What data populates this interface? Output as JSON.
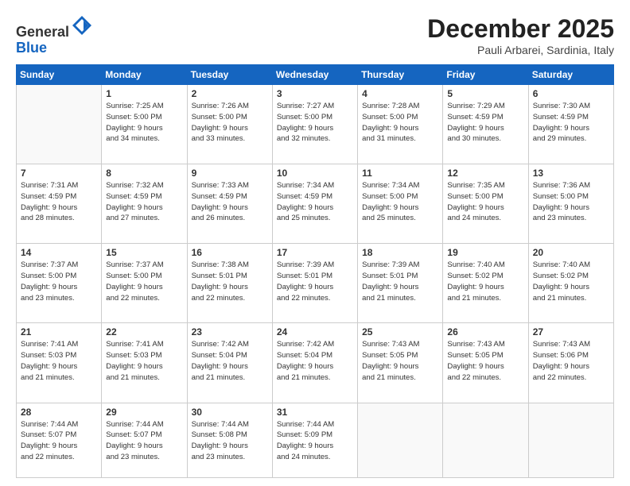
{
  "header": {
    "logo_general": "General",
    "logo_blue": "Blue",
    "month_title": "December 2025",
    "location": "Pauli Arbarei, Sardinia, Italy"
  },
  "weekdays": [
    "Sunday",
    "Monday",
    "Tuesday",
    "Wednesday",
    "Thursday",
    "Friday",
    "Saturday"
  ],
  "weeks": [
    [
      {
        "day": "",
        "info": ""
      },
      {
        "day": "1",
        "info": "Sunrise: 7:25 AM\nSunset: 5:00 PM\nDaylight: 9 hours\nand 34 minutes."
      },
      {
        "day": "2",
        "info": "Sunrise: 7:26 AM\nSunset: 5:00 PM\nDaylight: 9 hours\nand 33 minutes."
      },
      {
        "day": "3",
        "info": "Sunrise: 7:27 AM\nSunset: 5:00 PM\nDaylight: 9 hours\nand 32 minutes."
      },
      {
        "day": "4",
        "info": "Sunrise: 7:28 AM\nSunset: 5:00 PM\nDaylight: 9 hours\nand 31 minutes."
      },
      {
        "day": "5",
        "info": "Sunrise: 7:29 AM\nSunset: 4:59 PM\nDaylight: 9 hours\nand 30 minutes."
      },
      {
        "day": "6",
        "info": "Sunrise: 7:30 AM\nSunset: 4:59 PM\nDaylight: 9 hours\nand 29 minutes."
      }
    ],
    [
      {
        "day": "7",
        "info": "Sunrise: 7:31 AM\nSunset: 4:59 PM\nDaylight: 9 hours\nand 28 minutes."
      },
      {
        "day": "8",
        "info": "Sunrise: 7:32 AM\nSunset: 4:59 PM\nDaylight: 9 hours\nand 27 minutes."
      },
      {
        "day": "9",
        "info": "Sunrise: 7:33 AM\nSunset: 4:59 PM\nDaylight: 9 hours\nand 26 minutes."
      },
      {
        "day": "10",
        "info": "Sunrise: 7:34 AM\nSunset: 4:59 PM\nDaylight: 9 hours\nand 25 minutes."
      },
      {
        "day": "11",
        "info": "Sunrise: 7:34 AM\nSunset: 5:00 PM\nDaylight: 9 hours\nand 25 minutes."
      },
      {
        "day": "12",
        "info": "Sunrise: 7:35 AM\nSunset: 5:00 PM\nDaylight: 9 hours\nand 24 minutes."
      },
      {
        "day": "13",
        "info": "Sunrise: 7:36 AM\nSunset: 5:00 PM\nDaylight: 9 hours\nand 23 minutes."
      }
    ],
    [
      {
        "day": "14",
        "info": "Sunrise: 7:37 AM\nSunset: 5:00 PM\nDaylight: 9 hours\nand 23 minutes."
      },
      {
        "day": "15",
        "info": "Sunrise: 7:37 AM\nSunset: 5:00 PM\nDaylight: 9 hours\nand 22 minutes."
      },
      {
        "day": "16",
        "info": "Sunrise: 7:38 AM\nSunset: 5:01 PM\nDaylight: 9 hours\nand 22 minutes."
      },
      {
        "day": "17",
        "info": "Sunrise: 7:39 AM\nSunset: 5:01 PM\nDaylight: 9 hours\nand 22 minutes."
      },
      {
        "day": "18",
        "info": "Sunrise: 7:39 AM\nSunset: 5:01 PM\nDaylight: 9 hours\nand 21 minutes."
      },
      {
        "day": "19",
        "info": "Sunrise: 7:40 AM\nSunset: 5:02 PM\nDaylight: 9 hours\nand 21 minutes."
      },
      {
        "day": "20",
        "info": "Sunrise: 7:40 AM\nSunset: 5:02 PM\nDaylight: 9 hours\nand 21 minutes."
      }
    ],
    [
      {
        "day": "21",
        "info": "Sunrise: 7:41 AM\nSunset: 5:03 PM\nDaylight: 9 hours\nand 21 minutes."
      },
      {
        "day": "22",
        "info": "Sunrise: 7:41 AM\nSunset: 5:03 PM\nDaylight: 9 hours\nand 21 minutes."
      },
      {
        "day": "23",
        "info": "Sunrise: 7:42 AM\nSunset: 5:04 PM\nDaylight: 9 hours\nand 21 minutes."
      },
      {
        "day": "24",
        "info": "Sunrise: 7:42 AM\nSunset: 5:04 PM\nDaylight: 9 hours\nand 21 minutes."
      },
      {
        "day": "25",
        "info": "Sunrise: 7:43 AM\nSunset: 5:05 PM\nDaylight: 9 hours\nand 21 minutes."
      },
      {
        "day": "26",
        "info": "Sunrise: 7:43 AM\nSunset: 5:05 PM\nDaylight: 9 hours\nand 22 minutes."
      },
      {
        "day": "27",
        "info": "Sunrise: 7:43 AM\nSunset: 5:06 PM\nDaylight: 9 hours\nand 22 minutes."
      }
    ],
    [
      {
        "day": "28",
        "info": "Sunrise: 7:44 AM\nSunset: 5:07 PM\nDaylight: 9 hours\nand 22 minutes."
      },
      {
        "day": "29",
        "info": "Sunrise: 7:44 AM\nSunset: 5:07 PM\nDaylight: 9 hours\nand 23 minutes."
      },
      {
        "day": "30",
        "info": "Sunrise: 7:44 AM\nSunset: 5:08 PM\nDaylight: 9 hours\nand 23 minutes."
      },
      {
        "day": "31",
        "info": "Sunrise: 7:44 AM\nSunset: 5:09 PM\nDaylight: 9 hours\nand 24 minutes."
      },
      {
        "day": "",
        "info": ""
      },
      {
        "day": "",
        "info": ""
      },
      {
        "day": "",
        "info": ""
      }
    ]
  ]
}
